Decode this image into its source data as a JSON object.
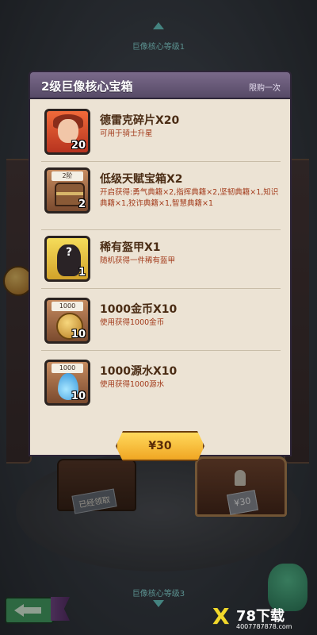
{
  "background": {
    "level_top": "巨像核心等级1",
    "level_bottom": "巨像核心等级3",
    "claimed_label": "已经领取",
    "price_label": "¥30"
  },
  "modal": {
    "title": "2级巨像核心宝箱",
    "limit": "限购一次",
    "items": [
      {
        "name": "德雷克碎片X20",
        "desc": "可用于骑士升星",
        "count": "20",
        "top_label": "",
        "icon": "drake-portrait-icon"
      },
      {
        "name": "低级天赋宝箱X2",
        "desc": "开启获得:勇气典籍×2,指挥典籍×2,坚韧典籍×1,知识典籍×1,狡诈典籍×1,智慧典籍×1",
        "count": "2",
        "top_label": "2阶",
        "icon": "talent-chest-icon"
      },
      {
        "name": "稀有盔甲X1",
        "desc": "随机获得一件稀有盔甲",
        "count": "1",
        "top_label": "",
        "icon": "mystery-armor-icon"
      },
      {
        "name": "1000金币X10",
        "desc": "使用获得1000金币",
        "count": "10",
        "top_label": "1000",
        "icon": "gold-coin-icon"
      },
      {
        "name": "1000源水X10",
        "desc": "使用获得1000源水",
        "count": "10",
        "top_label": "1000",
        "icon": "source-water-icon"
      }
    ],
    "buy_label": "¥30"
  },
  "watermark": {
    "mark": "X",
    "title": "78下载",
    "url": "4007787878.com"
  },
  "colors": {
    "panel_bg": "#ece3d4",
    "header_bg": "#6a5a7a",
    "name_color": "#4a2c14",
    "desc_color": "#a23a1a",
    "button_gold": "#f5b52f"
  }
}
